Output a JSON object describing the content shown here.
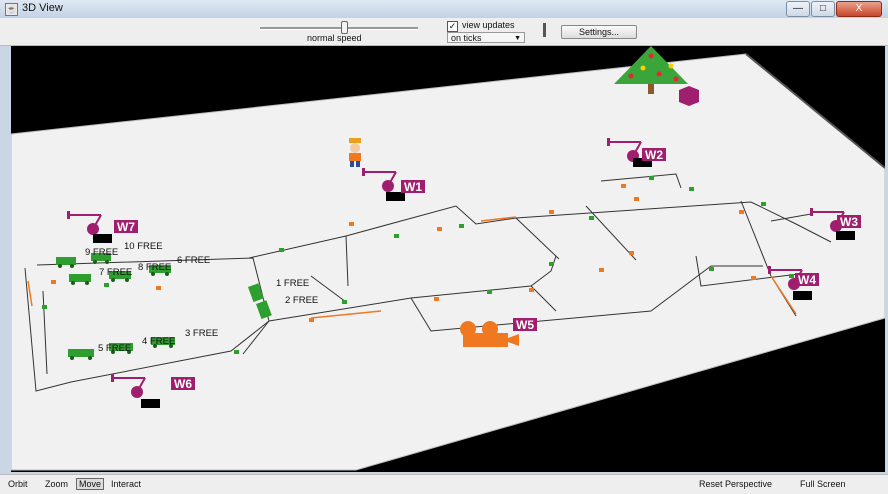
{
  "window": {
    "title": "3D View",
    "minimize": "—",
    "maximize": "□",
    "close": "X"
  },
  "toolbar": {
    "speed_label": "normal speed",
    "view_updates_label": "view updates",
    "view_updates_checked": "✓",
    "update_mode": "on ticks",
    "settings_label": "Settings..."
  },
  "scene": {
    "workstations": [
      "W1",
      "W2",
      "W3",
      "W4",
      "W5",
      "W6",
      "W7"
    ],
    "slots": [
      {
        "num": "1",
        "state": "FREE"
      },
      {
        "num": "2",
        "state": "FREE"
      },
      {
        "num": "3",
        "state": "FREE"
      },
      {
        "num": "4",
        "state": "FREE"
      },
      {
        "num": "5",
        "state": "FREE"
      },
      {
        "num": "6",
        "state": "FREE"
      },
      {
        "num": "7",
        "state": "FREE"
      },
      {
        "num": "8",
        "state": "FREE"
      },
      {
        "num": "9",
        "state": "FREE"
      },
      {
        "num": "10",
        "state": "FREE"
      }
    ],
    "colors": {
      "floor": "#f1f1f1",
      "background": "#000000",
      "robot": "#a01e6e",
      "label_bg": "#a01e6e",
      "camera": "#f07820",
      "cart": "#2e9e2e",
      "track": "#333333"
    }
  },
  "statusbar": {
    "orbit": "Orbit",
    "zoom": "Zoom",
    "move": "Move",
    "interact": "Interact",
    "reset": "Reset Perspective",
    "fullscreen": "Full Screen"
  }
}
